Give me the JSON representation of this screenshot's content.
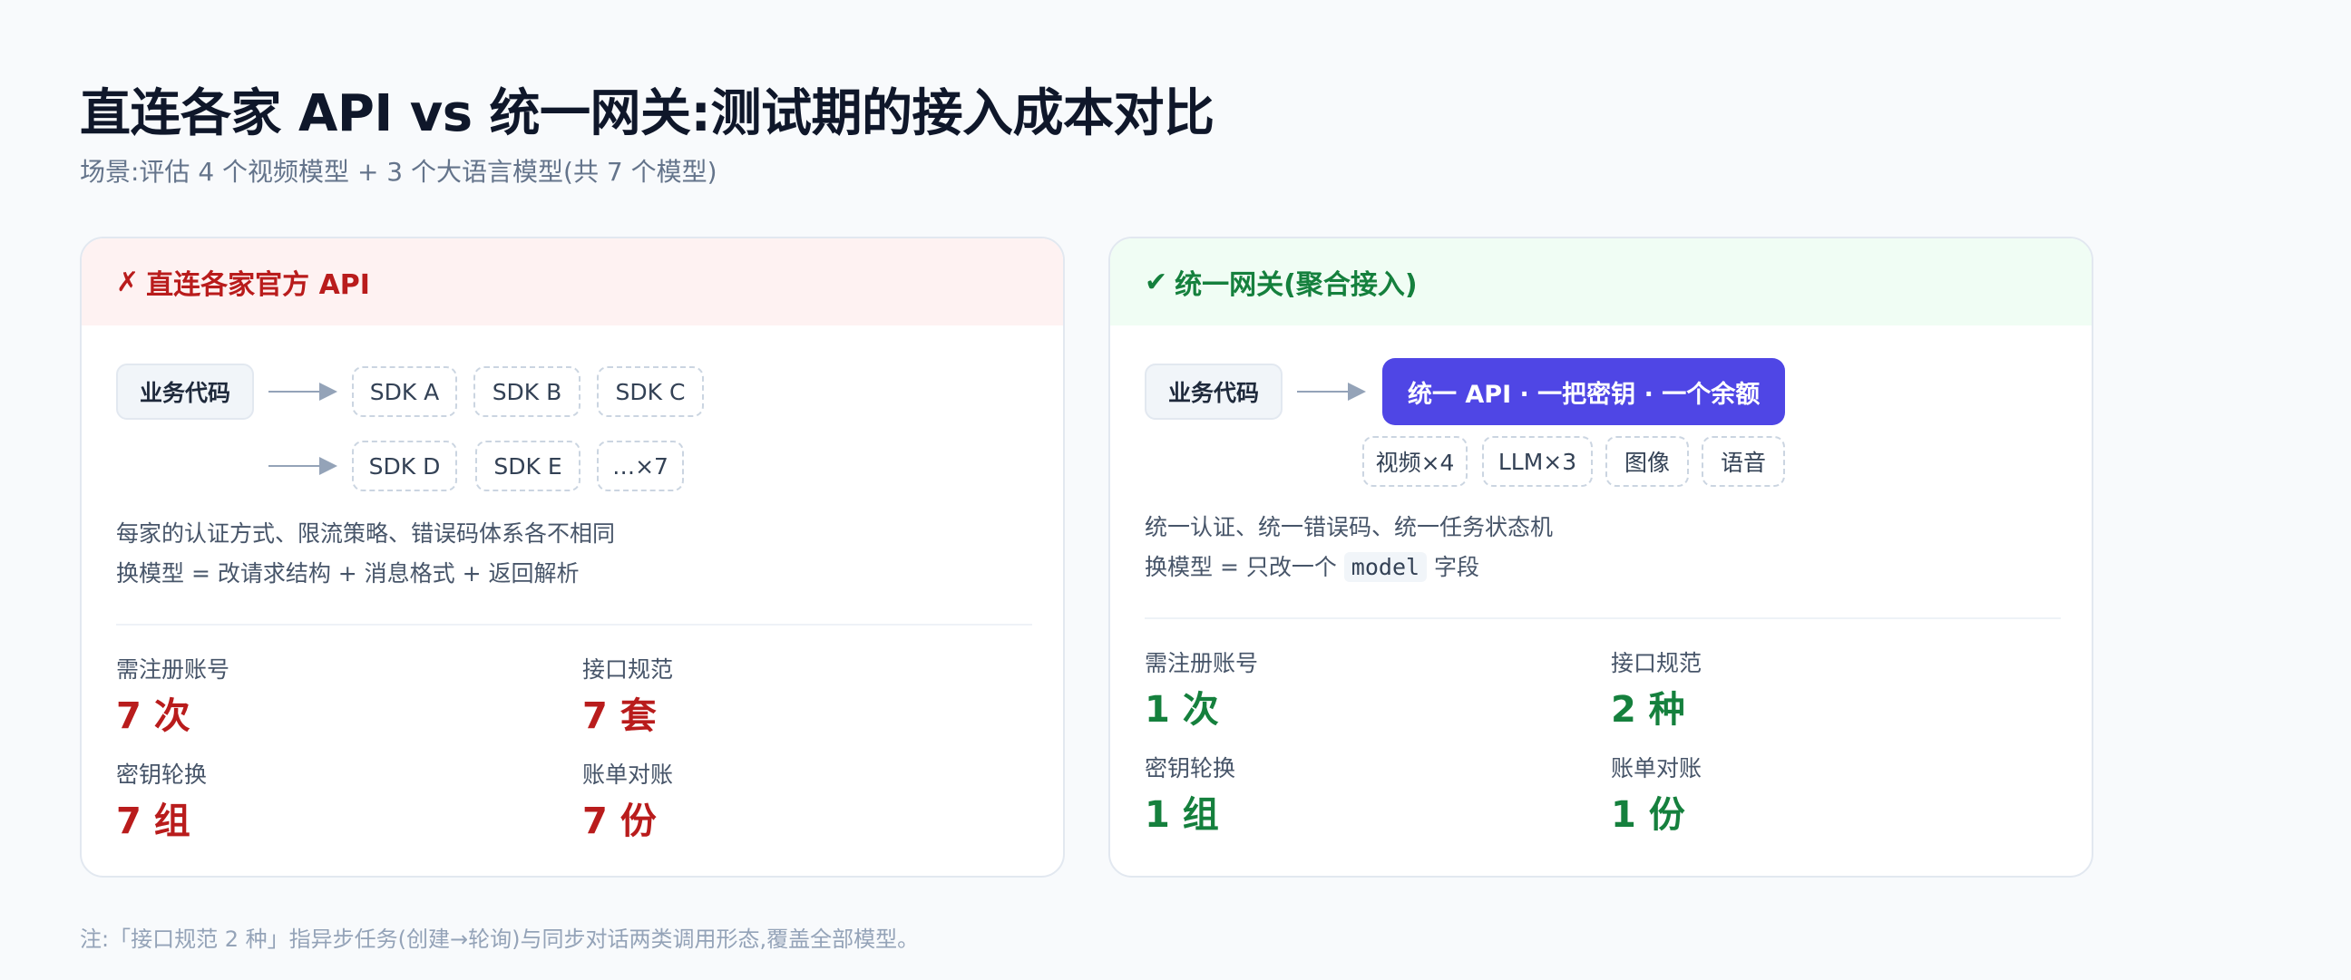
{
  "title": "直连各家 API vs 统一网关:测试期的接入成本对比",
  "subtitle": "场景:评估 4 个视频模型 + 3 个大语言模型(共 7 个模型)",
  "left_card": {
    "mark": "✗",
    "heading": "直连各家官方 API",
    "business_code": "业务代码",
    "sdks_row1": [
      "SDK A",
      "SDK B",
      "SDK C"
    ],
    "sdks_row2": [
      "SDK D",
      "SDK E",
      "…×7"
    ],
    "desc_line1": "每家的认证方式、限流策略、错误码体系各不相同",
    "desc_line2": "换模型 = 改请求结构 + 消息格式 + 返回解析",
    "metrics": [
      {
        "label": "需注册账号",
        "value": "7 次"
      },
      {
        "label": "接口规范",
        "value": "7 套"
      },
      {
        "label": "密钥轮换",
        "value": "7 组"
      },
      {
        "label": "账单对账",
        "value": "7 份"
      }
    ]
  },
  "right_card": {
    "mark": "✔",
    "heading": "统一网关(聚合接入)",
    "business_code": "业务代码",
    "gateway_label": "统一 API · 一把密钥 · 一个余额",
    "capabilities": [
      "视频×4",
      "LLM×3",
      "图像",
      "语音"
    ],
    "desc_line1": "统一认证、统一错误码、统一任务状态机",
    "desc_line2_prefix": "换模型 = 只改一个",
    "desc_line2_code": "model",
    "desc_line2_suffix": "字段",
    "metrics": [
      {
        "label": "需注册账号",
        "value": "1 次"
      },
      {
        "label": "接口规范",
        "value": "2 种"
      },
      {
        "label": "密钥轮换",
        "value": "1 组"
      },
      {
        "label": "账单对账",
        "value": "1 份"
      }
    ]
  },
  "footnote": "注:「接口规范 2 种」指异步任务(创建→轮询)与同步对话两类调用形态,覆盖全部模型。",
  "colors": {
    "bad": "#b91c1c",
    "good": "#15803d",
    "gateway": "#4f46e5"
  }
}
